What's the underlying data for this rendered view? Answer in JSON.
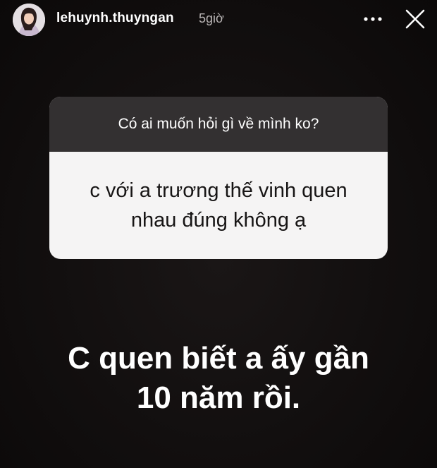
{
  "header": {
    "username": "lehuynh.thuyngan",
    "time": "5giờ",
    "more_icon": "more-horizontal-icon",
    "close_icon": "close-icon"
  },
  "question_sticker": {
    "prompt": "Có ai muốn hỏi gì về mình ko?",
    "answer_line_1": "c với a trương thế vinh quen",
    "answer_line_2": "nhau đúng không ạ"
  },
  "reply": {
    "line_1": "C quen biết a ấy gần",
    "line_2": "10 năm rồi."
  },
  "colors": {
    "background": "#110e0e",
    "sticker_header": "#333031",
    "sticker_body": "#f5f4f4"
  }
}
